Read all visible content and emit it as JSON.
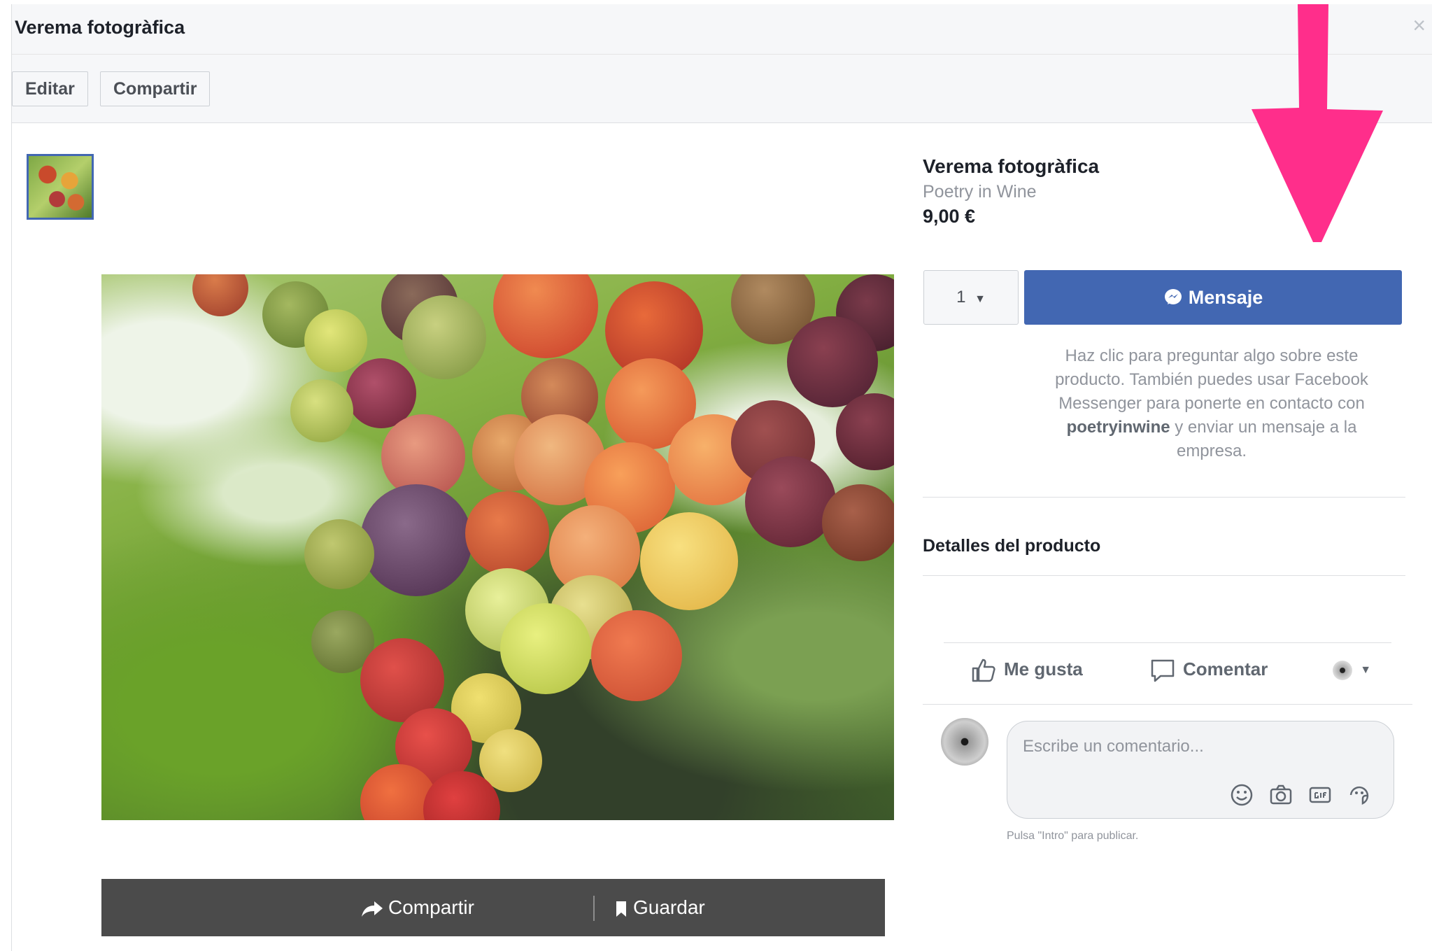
{
  "header": {
    "title": "Verema fotogràfica",
    "close_label": "×"
  },
  "toolbar": {
    "edit_label": "Editar",
    "share_label": "Compartir"
  },
  "photo_bar": {
    "share_label": "Compartir",
    "save_label": "Guardar"
  },
  "product": {
    "title": "Verema fotogràfica",
    "seller": "Poetry in Wine",
    "price": "9,00 €",
    "quantity": "1",
    "message_button": "Mensaje",
    "help_pre": "Haz clic para preguntar algo sobre este producto. También puedes usar Facebook Messenger para ponerte en contacto con",
    "help_handle": "poetryinwine",
    "help_post": "y enviar un mensaje a la empresa.",
    "details_title": "Detalles del producto"
  },
  "actions": {
    "like_label": "Me gusta",
    "comment_label": "Comentar"
  },
  "comment": {
    "placeholder": "Escribe un comentario...",
    "hint": "Pulsa \"Intro\" para publicar."
  },
  "colors": {
    "brand_blue": "#4267b2",
    "annotation_pink": "#ff2e8b",
    "photo_bar": "#4b4b4b"
  }
}
